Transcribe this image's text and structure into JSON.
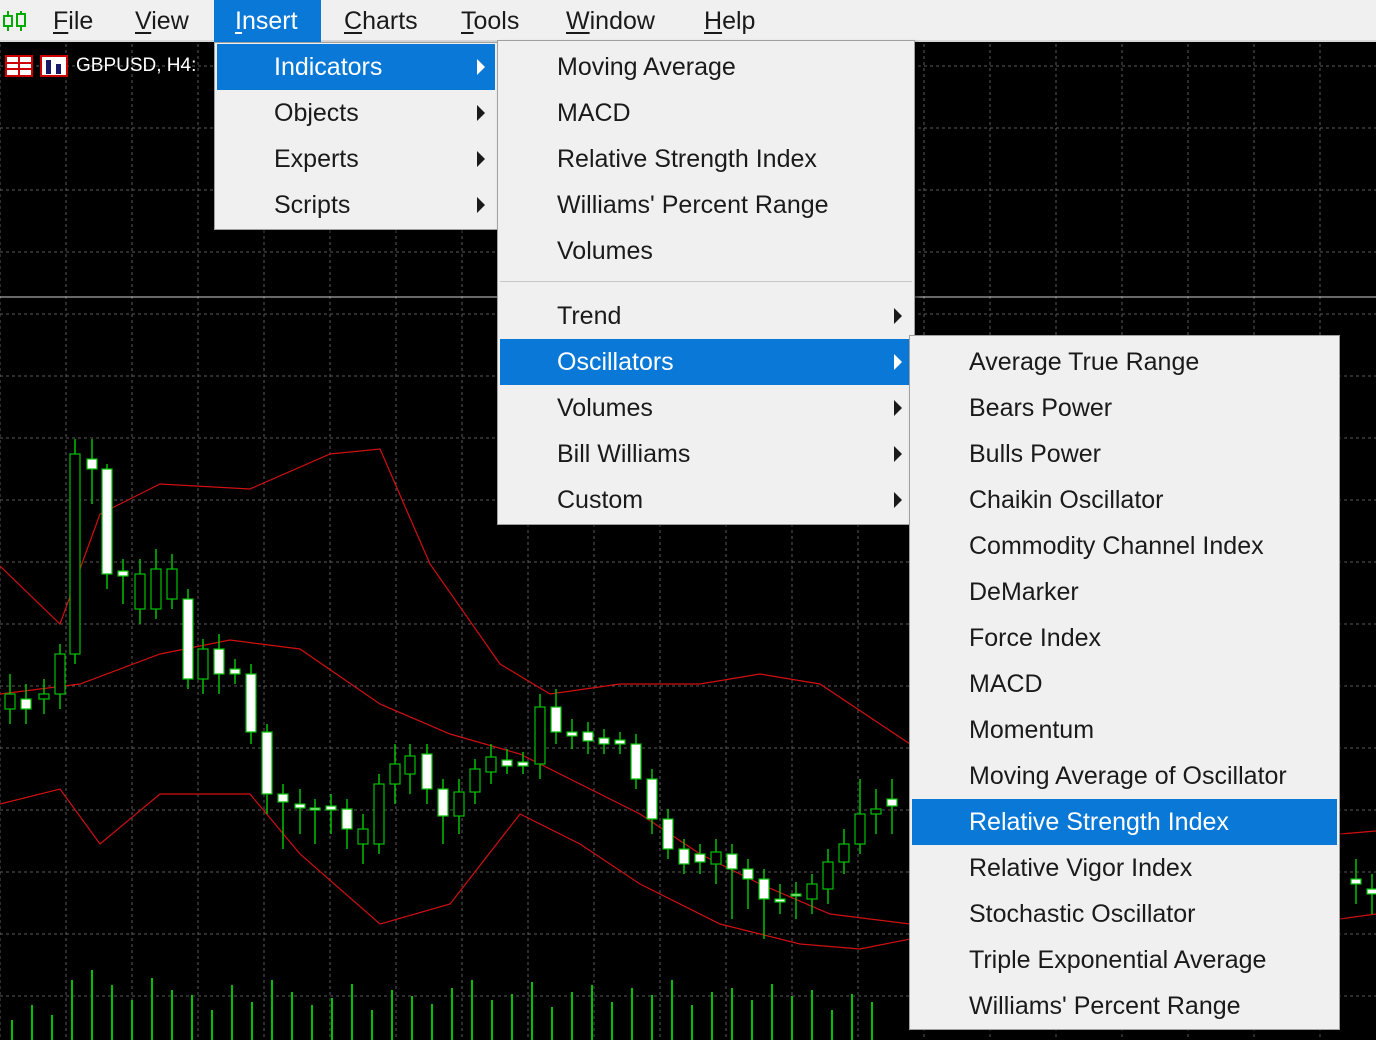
{
  "menubar": {
    "items": [
      {
        "pre": "",
        "ul": "F",
        "post": "ile"
      },
      {
        "pre": "",
        "ul": "V",
        "post": "iew"
      },
      {
        "pre": "",
        "ul": "I",
        "post": "nsert"
      },
      {
        "pre": "",
        "ul": "C",
        "post": "harts"
      },
      {
        "pre": "",
        "ul": "T",
        "post": "ools"
      },
      {
        "pre": "",
        "ul": "W",
        "post": "indow"
      },
      {
        "pre": "",
        "ul": "H",
        "post": "elp"
      }
    ]
  },
  "chart_tab": {
    "title": "GBPUSD, H4:"
  },
  "insert_menu": {
    "items": [
      "Indicators",
      "Objects",
      "Experts",
      "Scripts"
    ]
  },
  "indicators_menu": {
    "items": [
      "Moving Average",
      "MACD",
      "Relative Strength Index",
      "Williams' Percent Range",
      "Volumes"
    ],
    "groups": [
      "Trend",
      "Oscillators",
      "Volumes",
      "Bill Williams",
      "Custom"
    ]
  },
  "oscillators_menu": {
    "items": [
      "Average True Range",
      "Bears Power",
      "Bulls Power",
      "Chaikin Oscillator",
      "Commodity Channel Index",
      "DeMarker",
      "Force Index",
      "MACD",
      "Momentum",
      "Moving Average of Oscillator",
      "Relative Strength Index",
      "Relative Vigor Index",
      "Stochastic Oscillator",
      "Triple Exponential Average",
      "Williams' Percent Range"
    ]
  },
  "colors": {
    "menu_bg": "#f0f0f0",
    "highlight": "#0a78d7",
    "chart_bg": "#000000",
    "candle": "#00c000",
    "bands": "#d01010",
    "grid": "#5a5a5a"
  }
}
